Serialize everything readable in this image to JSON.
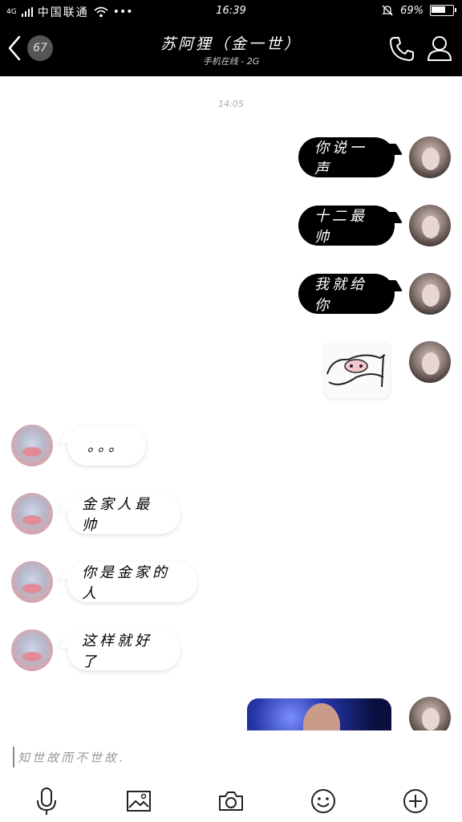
{
  "status_bar": {
    "network": "4G",
    "carrier": "中国联通",
    "dots": "•••",
    "time": "16:39",
    "battery": "69%",
    "battery_level": 0.69
  },
  "header": {
    "unread_count": "67",
    "contact_name": "苏阿狸（金一世）",
    "status": "手机在线 - 2G"
  },
  "chat": {
    "timestamp": "14:05",
    "messages": [
      {
        "from": "me",
        "type": "text",
        "text": "你说一声"
      },
      {
        "from": "me",
        "type": "text",
        "text": "十二最帅"
      },
      {
        "from": "me",
        "type": "text",
        "text": "我就给你"
      },
      {
        "from": "me",
        "type": "sticker",
        "icon": "sticker-image"
      },
      {
        "from": "other",
        "type": "text",
        "text": "。。。"
      },
      {
        "from": "other",
        "type": "text",
        "text": "金家人最帅"
      },
      {
        "from": "other",
        "type": "text",
        "text": "你是金家的人"
      },
      {
        "from": "other",
        "type": "text",
        "text": "这样就好了"
      },
      {
        "from": "me",
        "type": "photo",
        "icon": "concert-photo"
      }
    ]
  },
  "input": {
    "placeholder": "知世故而不世故.",
    "value": ""
  },
  "toolbar": {
    "icons": [
      "microphone-icon",
      "image-icon",
      "camera-icon",
      "emoji-icon",
      "plus-icon"
    ]
  },
  "colors": {
    "header_bg": "#000000",
    "outgoing_bubble": "#000000",
    "incoming_bubble": "#ffffff"
  }
}
